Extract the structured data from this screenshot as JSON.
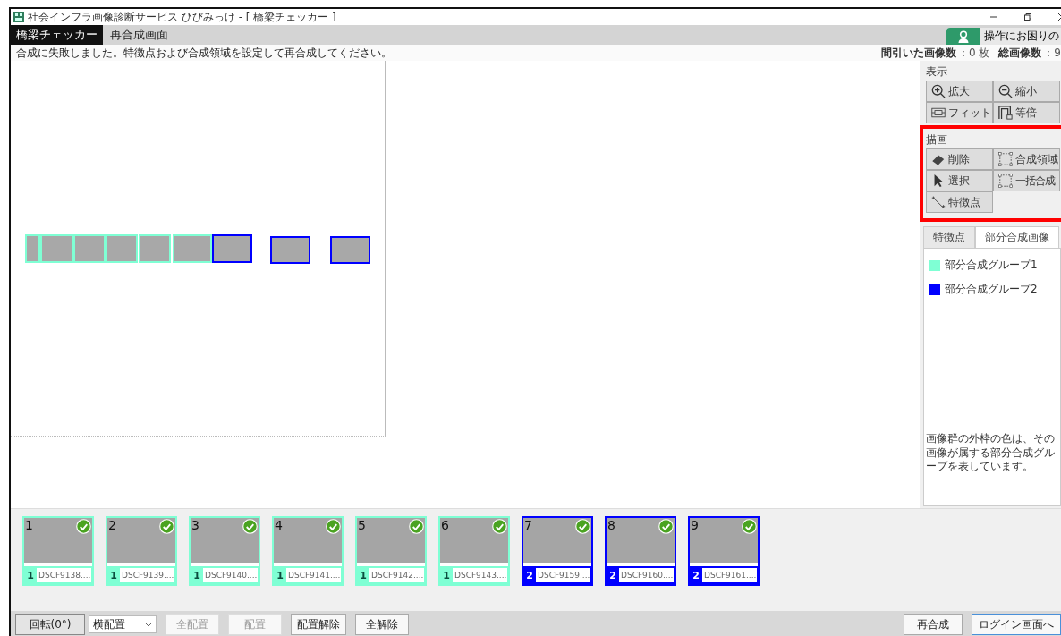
{
  "window": {
    "title": "社会インフラ画像診断サービス ひびみっけ - [ 橋梁チェッカー ]"
  },
  "header": {
    "app_tab": "橋梁チェッカー",
    "screen_title": "再合成画面",
    "help_button": "操作にお困りの"
  },
  "message": "合成に失敗しました。特徴点および合成領域を設定して再合成してください。",
  "counts": [
    {
      "label": "間引いた画像数",
      "value": "：0 枚"
    },
    {
      "label": "総画像数",
      "value": "：9"
    }
  ],
  "canvas_tiles": [
    {
      "color": "#7fffd4"
    },
    {
      "color": "#7fffd4"
    },
    {
      "color": "#7fffd4"
    },
    {
      "color": "#7fffd4"
    },
    {
      "color": "#7fffd4"
    },
    {
      "color": "#7fffd4"
    },
    {
      "color": "#0000ff"
    },
    {
      "color": "#0000ff"
    },
    {
      "color": "#0000ff"
    }
  ],
  "view_section": {
    "title": "表示",
    "buttons": [
      {
        "kind": "zoom-in",
        "label": "拡大"
      },
      {
        "kind": "zoom-out",
        "label": "縮小"
      },
      {
        "kind": "fit",
        "label": "フィット"
      },
      {
        "kind": "actual",
        "label": "等倍"
      }
    ]
  },
  "draw_section": {
    "title": "描画",
    "buttons": [
      {
        "kind": "eraser",
        "label": "削除"
      },
      {
        "kind": "region",
        "label": "合成領域"
      },
      {
        "kind": "pointer",
        "label": "選択"
      },
      {
        "kind": "region-small",
        "label": "一括合成"
      },
      {
        "kind": "feature",
        "label": "特徴点"
      }
    ]
  },
  "tabs": [
    {
      "label": "特徴点",
      "selected": false
    },
    {
      "label": "部分合成画像",
      "selected": true
    }
  ],
  "groups": [
    {
      "name": "部分合成グループ1",
      "color": "#7fffd4"
    },
    {
      "name": "部分合成グループ2",
      "color": "#0000ff"
    }
  ],
  "note": "画像群の外枠の色は、その画像が属する部分合成グループを表しています。",
  "thumbnails": [
    {
      "number": "1",
      "group": "1",
      "file": "DSCF9138....",
      "color": "#7fffd4",
      "checked": true
    },
    {
      "number": "2",
      "group": "1",
      "file": "DSCF9139....",
      "color": "#7fffd4",
      "checked": true
    },
    {
      "number": "3",
      "group": "1",
      "file": "DSCF9140....",
      "color": "#7fffd4",
      "checked": true
    },
    {
      "number": "4",
      "group": "1",
      "file": "DSCF9141....",
      "color": "#7fffd4",
      "checked": true
    },
    {
      "number": "5",
      "group": "1",
      "file": "DSCF9142....",
      "color": "#7fffd4",
      "checked": true
    },
    {
      "number": "6",
      "group": "1",
      "file": "DSCF9143....",
      "color": "#7fffd4",
      "checked": true
    },
    {
      "number": "7",
      "group": "2",
      "file": "DSCF9159....",
      "color": "#0000ff",
      "checked": true
    },
    {
      "number": "8",
      "group": "2",
      "file": "DSCF9160....",
      "color": "#0000ff",
      "checked": true
    },
    {
      "number": "9",
      "group": "2",
      "file": "DSCF9161....",
      "color": "#0000ff",
      "checked": true
    }
  ],
  "toolbar": {
    "rotate": "回転(0°)",
    "layout_select": "横配置",
    "buttons": [
      {
        "label": "全配置",
        "disabled": true
      },
      {
        "label": "配置",
        "disabled": true
      },
      {
        "label": "配置解除",
        "disabled": false
      },
      {
        "label": "全解除",
        "disabled": false
      }
    ],
    "right_buttons": [
      {
        "label": "再合成",
        "selected": false
      },
      {
        "label": "ログイン画面へ",
        "selected": true
      }
    ]
  }
}
